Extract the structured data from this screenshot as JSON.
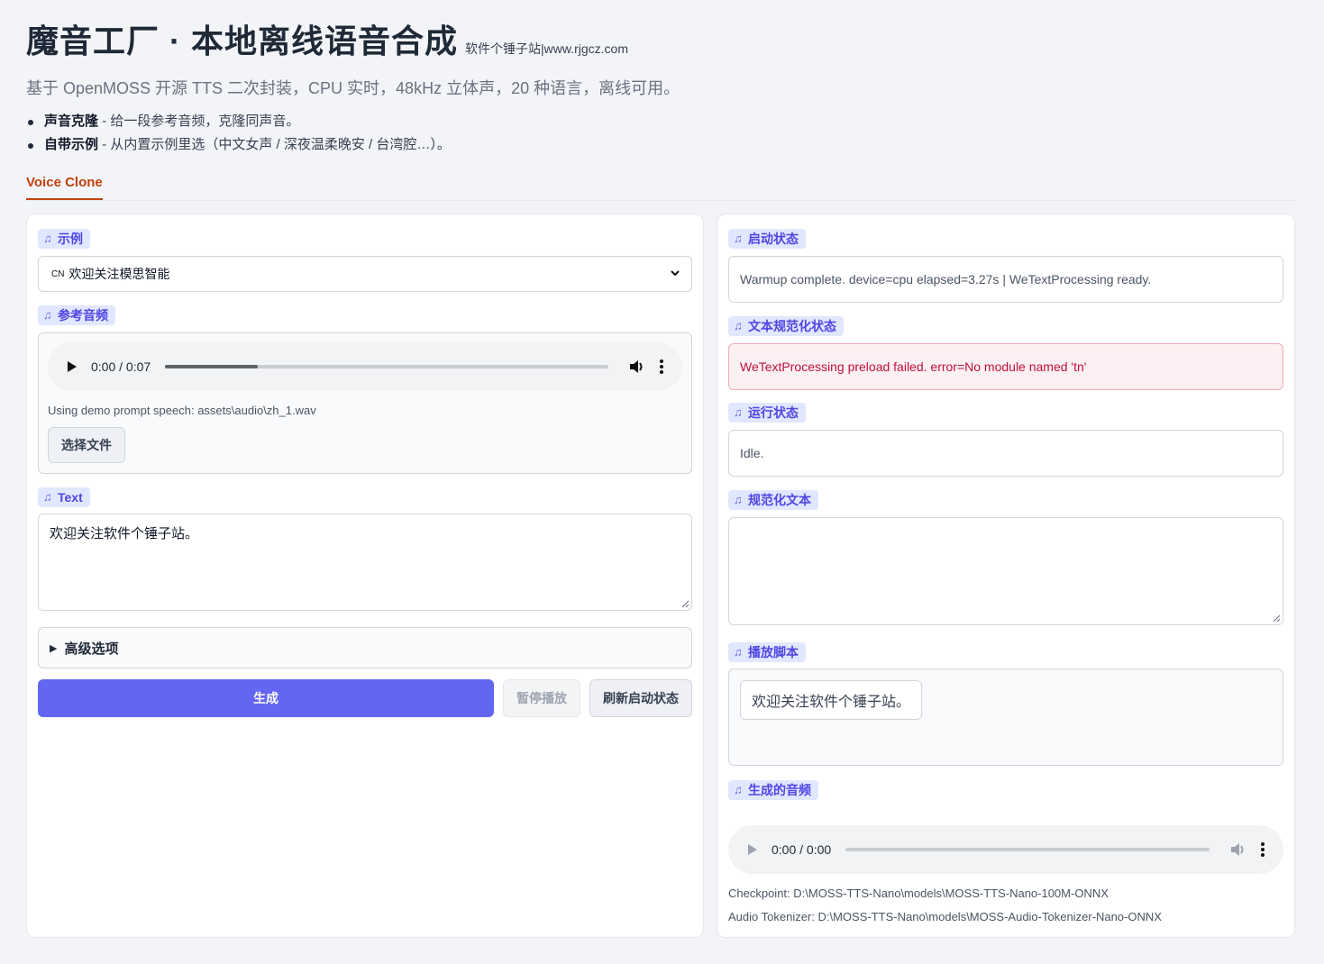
{
  "header": {
    "title": "魔音工厂 · 本地离线语音合成",
    "site": "软件个锤子站|www.rjgcz.com",
    "subtitle": "基于 OpenMOSS 开源 TTS 二次封装，CPU 实时，48kHz 立体声，20 种语言，离线可用。",
    "features": [
      {
        "name": "声音克隆",
        "desc": " - 给一段参考音频，克隆同声音。"
      },
      {
        "name": "自带示例",
        "desc": " - 从内置示例里选（中文女声 / 深夜温柔晚安 / 台湾腔…）。"
      }
    ]
  },
  "tabs": [
    {
      "label": "Voice Clone",
      "active": true
    }
  ],
  "left": {
    "example": {
      "label": "示例",
      "flag": "CN",
      "selected": "欢迎关注模思智能"
    },
    "reference_audio": {
      "label": "参考音频",
      "time": "0:00 / 0:07",
      "progress": 0.21,
      "note": "Using demo prompt speech: assets\\audio\\zh_1.wav",
      "file_button": "选择文件"
    },
    "text": {
      "label": "Text",
      "value": "欢迎关注软件个锤子站。"
    },
    "advanced": {
      "label": "高级选项"
    },
    "buttons": {
      "generate": "生成",
      "pause": "暂停播放",
      "refresh": "刷新启动状态"
    }
  },
  "right": {
    "startup": {
      "label": "启动状态",
      "value": "Warmup complete. device=cpu elapsed=3.27s | WeTextProcessing ready."
    },
    "normalize_status": {
      "label": "文本规范化状态",
      "value": "WeTextProcessing preload failed. error=No module named 'tn'"
    },
    "run_status": {
      "label": "运行状态",
      "value": "Idle."
    },
    "normalized_text": {
      "label": "规范化文本",
      "value": ""
    },
    "script": {
      "label": "播放脚本",
      "chip": "欢迎关注软件个锤子站。"
    },
    "output_audio": {
      "label": "生成的音频",
      "time": "0:00 / 0:00",
      "progress": 0
    },
    "checkpoint": "Checkpoint: D:\\MOSS-TTS-Nano\\models\\MOSS-TTS-Nano-100M-ONNX",
    "tokenizer": "Audio Tokenizer: D:\\MOSS-TTS-Nano\\models\\MOSS-Audio-Tokenizer-Nano-ONNX"
  },
  "colors": {
    "accent": "#6366f1",
    "tab": "#c2410c",
    "error_bg": "#fdf0f2",
    "error_text": "#be123c"
  }
}
